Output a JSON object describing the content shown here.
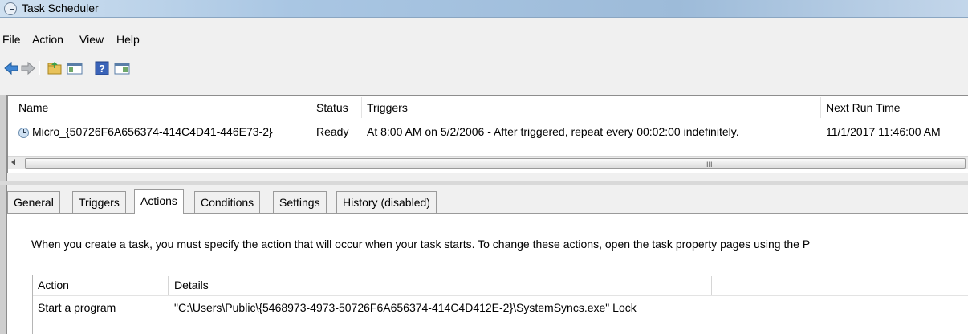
{
  "window": {
    "title": "Task Scheduler"
  },
  "menu": [
    "File",
    "Action",
    "View",
    "Help"
  ],
  "toolbar": {
    "buttons": [
      "back-icon",
      "forward-icon",
      "up-folder-icon",
      "show-hide-console-tree-icon",
      "help-icon",
      "show-hide-action-pane-icon"
    ]
  },
  "task_list": {
    "columns": {
      "name": "Name",
      "status": "Status",
      "triggers": "Triggers",
      "next_run": "Next Run Time"
    },
    "rows": [
      {
        "name": "Micro_{50726F6A656374-414C4D41-446E73-2}",
        "status": "Ready",
        "triggers": "At 8:00 AM on 5/2/2006 - After triggered, repeat every 00:02:00 indefinitely.",
        "next_run": "11/1/2017 11:46:00 AM"
      }
    ],
    "scroll_grip": "III"
  },
  "tabs": [
    {
      "label": "General",
      "active": false
    },
    {
      "label": "Triggers",
      "active": false
    },
    {
      "label": "Actions",
      "active": true
    },
    {
      "label": "Conditions",
      "active": false
    },
    {
      "label": "Settings",
      "active": false
    },
    {
      "label": "History (disabled)",
      "active": false
    }
  ],
  "actions_panel": {
    "description": "When you create a task, you must specify the action that will occur when your task starts.  To change these actions, open the task property pages using the P",
    "columns": {
      "action": "Action",
      "details": "Details"
    },
    "rows": [
      {
        "action": "Start a program",
        "details": "\"C:\\Users\\Public\\{5468973-4973-50726F6A656374-414C4D412E-2}\\SystemSyncs.exe\" Lock"
      }
    ]
  },
  "colors": {
    "titlebar": "#a9c6e3",
    "background": "#f0f0f0"
  }
}
